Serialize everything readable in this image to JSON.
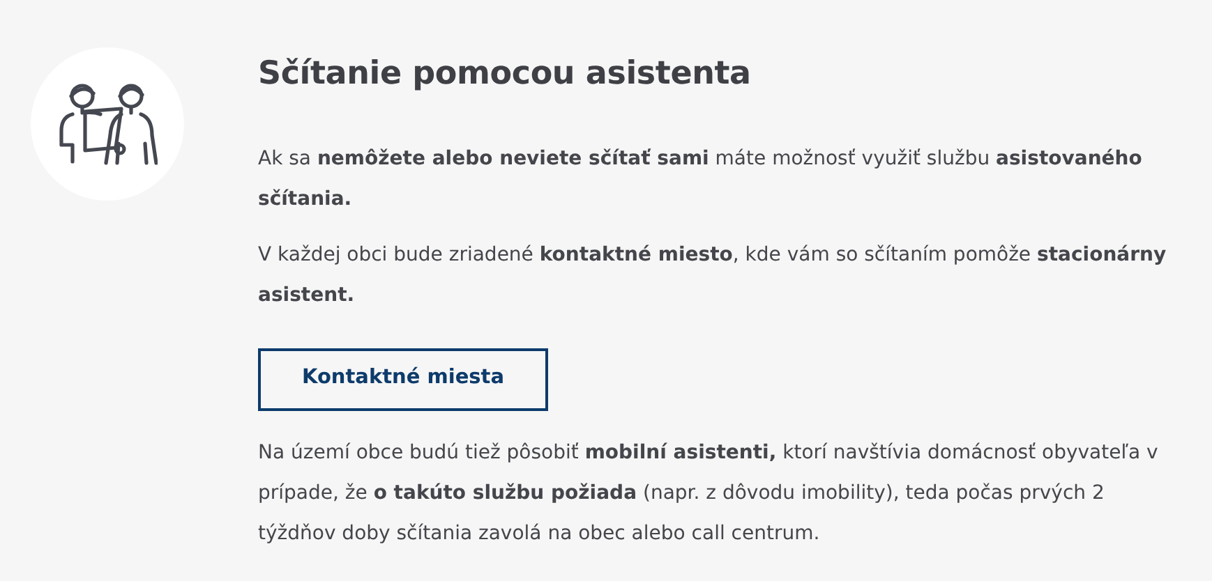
{
  "title": "Sčítanie pomocou asistenta",
  "paragraphs": [
    "Ak sa **nemôžete alebo neviete sčítať sami** máte možnosť využiť službu **asistovaného sčítania.**",
    "V každej obci bude zriadené **kontaktné miesto**, kde vám so sčítaním pomôže **stacionárny asistent.**"
  ],
  "button": "Kontaktné miesta",
  "footer_paragraph": "Na území obce budú tiež pôsobiť **mobilní asistenti,** ktorí navštívia domácnosť obyvateľa v prípade, že **o takúto službu požiada** (napr. z dôvodu imobility), teda počas prvých 2 týždňov doby sčítania zavolá na obec alebo call centrum."
}
